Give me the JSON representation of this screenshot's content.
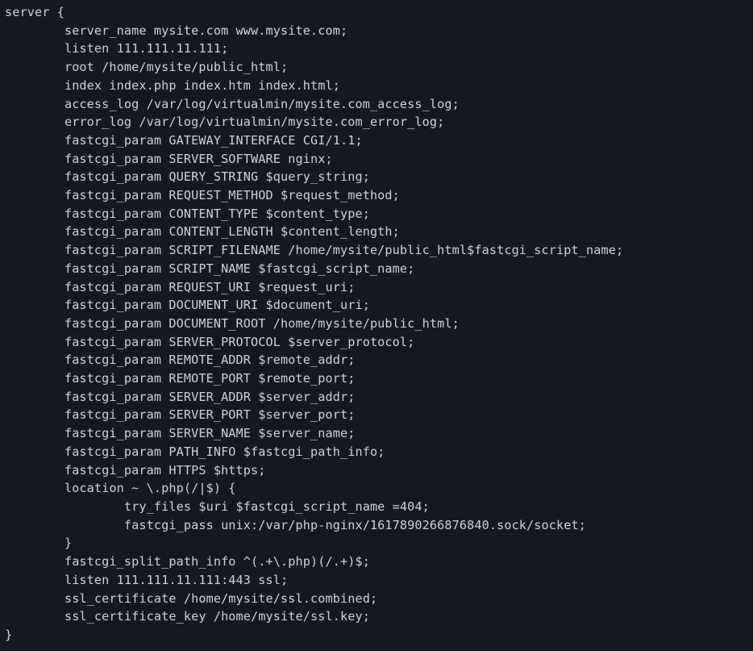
{
  "config": {
    "lines": [
      "server {",
      "        server_name mysite.com www.mysite.com;",
      "        listen 111.111.11.111;",
      "        root /home/mysite/public_html;",
      "        index index.php index.htm index.html;",
      "        access_log /var/log/virtualmin/mysite.com_access_log;",
      "        error_log /var/log/virtualmin/mysite.com_error_log;",
      "        fastcgi_param GATEWAY_INTERFACE CGI/1.1;",
      "        fastcgi_param SERVER_SOFTWARE nginx;",
      "        fastcgi_param QUERY_STRING $query_string;",
      "        fastcgi_param REQUEST_METHOD $request_method;",
      "        fastcgi_param CONTENT_TYPE $content_type;",
      "        fastcgi_param CONTENT_LENGTH $content_length;",
      "        fastcgi_param SCRIPT_FILENAME /home/mysite/public_html$fastcgi_script_name;",
      "        fastcgi_param SCRIPT_NAME $fastcgi_script_name;",
      "        fastcgi_param REQUEST_URI $request_uri;",
      "        fastcgi_param DOCUMENT_URI $document_uri;",
      "        fastcgi_param DOCUMENT_ROOT /home/mysite/public_html;",
      "        fastcgi_param SERVER_PROTOCOL $server_protocol;",
      "        fastcgi_param REMOTE_ADDR $remote_addr;",
      "        fastcgi_param REMOTE_PORT $remote_port;",
      "        fastcgi_param SERVER_ADDR $server_addr;",
      "        fastcgi_param SERVER_PORT $server_port;",
      "        fastcgi_param SERVER_NAME $server_name;",
      "        fastcgi_param PATH_INFO $fastcgi_path_info;",
      "        fastcgi_param HTTPS $https;",
      "        location ~ \\.php(/|$) {",
      "                try_files $uri $fastcgi_script_name =404;",
      "                fastcgi_pass unix:/var/php-nginx/1617890266876840.sock/socket;",
      "        }",
      "        fastcgi_split_path_info ^(.+\\.php)(/.+)$;",
      "        listen 111.111.11.111:443 ssl;",
      "        ssl_certificate /home/mysite/ssl.combined;",
      "        ssl_certificate_key /home/mysite/ssl.key;",
      "}"
    ]
  }
}
